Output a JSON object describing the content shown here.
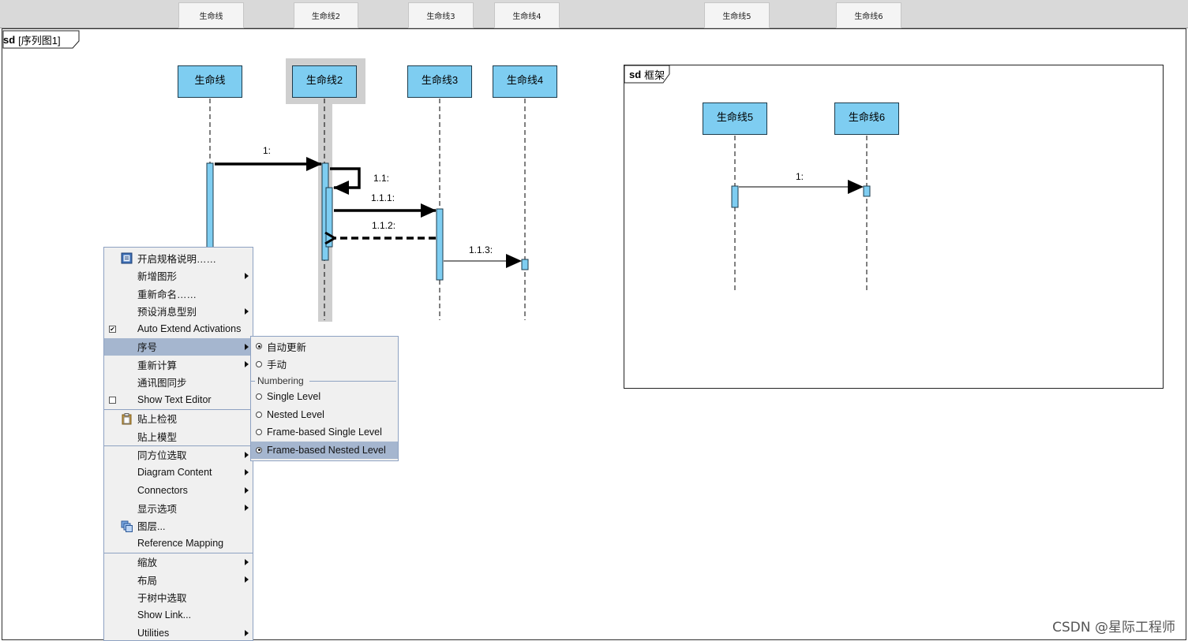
{
  "top_bar": {
    "cells": [
      "生命线",
      "生命线2",
      "生命线3",
      "生命线4",
      "生命线5",
      "生命线6"
    ]
  },
  "diagram": {
    "kind": "sd",
    "name": "[序列图1]"
  },
  "lifelines": [
    "生命线",
    "生命线2",
    "生命线3",
    "生命线4"
  ],
  "messages": {
    "m1": "1:",
    "m11": "1.1:",
    "m111": "1.1.1:",
    "m112": "1.1.2:",
    "m113": "1.1.3:"
  },
  "frame": {
    "kind": "sd",
    "name": "框架",
    "lifelines": [
      "生命线5",
      "生命线6"
    ],
    "message": "1:"
  },
  "context_menu": {
    "items": [
      {
        "label": "开启规格说明……",
        "icon": "spec-icon",
        "submenu": false
      },
      {
        "label": "新增图形",
        "submenu": true
      },
      {
        "label": "重新命名……",
        "submenu": false
      },
      {
        "label": "预设消息型别",
        "submenu": true
      },
      {
        "label": "Auto Extend Activations",
        "checked": true
      },
      {
        "label": "序号",
        "submenu": true,
        "highlighted": true
      },
      {
        "label": "重新计算",
        "submenu": true
      },
      {
        "label": "通讯图同步",
        "submenu": false
      },
      {
        "label": "Show Text Editor",
        "checked": false
      },
      {
        "label": "贴上检视",
        "icon": "clipboard-icon"
      },
      {
        "label": "贴上模型"
      },
      {
        "label": "同方位选取",
        "submenu": true
      },
      {
        "label": "Diagram Content",
        "submenu": true
      },
      {
        "label": "Connectors",
        "submenu": true
      },
      {
        "label": "显示选项",
        "submenu": true
      },
      {
        "label": "图层...",
        "icon": "layers-icon"
      },
      {
        "label": "Reference Mapping"
      },
      {
        "label": "缩放",
        "submenu": true
      },
      {
        "label": "布局",
        "submenu": true
      },
      {
        "label": "于树中选取"
      },
      {
        "label": "Show Link..."
      },
      {
        "label": "Utilities",
        "submenu": true
      }
    ]
  },
  "submenu": {
    "auto_update": "自动更新",
    "manual": "手动",
    "numbering_header": "Numbering",
    "single_level": "Single Level",
    "nested_level": "Nested Level",
    "frame_single": "Frame-based Single Level",
    "frame_nested": "Frame-based Nested Level",
    "selected_mode": "自动更新",
    "selected_numbering": "Frame-based Nested Level"
  },
  "watermark": "CSDN @星际工程师",
  "colors": {
    "lifeline_fill": "#7ecdf1",
    "menu_highlight": "#a5b6cf",
    "menu_background": "#f0f0f0",
    "selection_halo": "#cfcfcf"
  }
}
